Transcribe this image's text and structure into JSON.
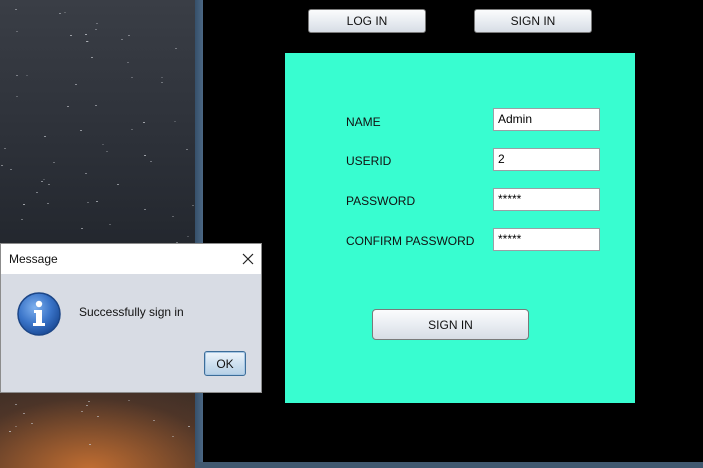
{
  "toolbar": {
    "login_label": "LOG IN",
    "signin_label": "SIGN IN"
  },
  "form": {
    "fields": [
      {
        "label": "NAME",
        "value": "Admin"
      },
      {
        "label": "USERID",
        "value": "2"
      },
      {
        "label": "PASSWORD",
        "value": "*****"
      },
      {
        "label": "CONFIRM PASSWORD",
        "value": "*****"
      }
    ],
    "submit_label": "SIGN IN",
    "panel_color": "#38fdd0"
  },
  "dialog": {
    "title": "Message",
    "message": "Successfully sign in",
    "ok_label": "OK",
    "icon": "info-icon",
    "close_icon": "close-icon"
  }
}
